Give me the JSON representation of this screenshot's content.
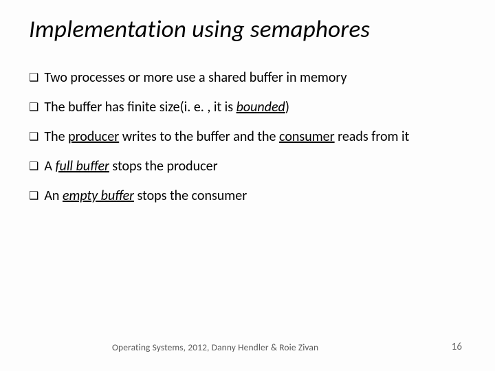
{
  "title": "Implementation using semaphores",
  "bullets": {
    "b1": "Two processes or more use a shared buffer in memory",
    "b2_a": "The buffer has finite size(i. e. , it is ",
    "b2_em": "bounded",
    "b2_c": ")",
    "b3_a": "The ",
    "b3_u1": "producer",
    "b3_b": " writes to the buffer and the ",
    "b3_u2": "consumer",
    "b3_c": " reads from it",
    "b4_a": "A ",
    "b4_em": "full buffer",
    "b4_b": " stops the producer",
    "b5_a": "An ",
    "b5_em": "empty buffer",
    "b5_b": " stops the consumer"
  },
  "bullet_glyph": "❑",
  "footer": {
    "credit": "Operating Systems, 2012,  Danny Hendler & Roie Zivan",
    "page": "16"
  }
}
